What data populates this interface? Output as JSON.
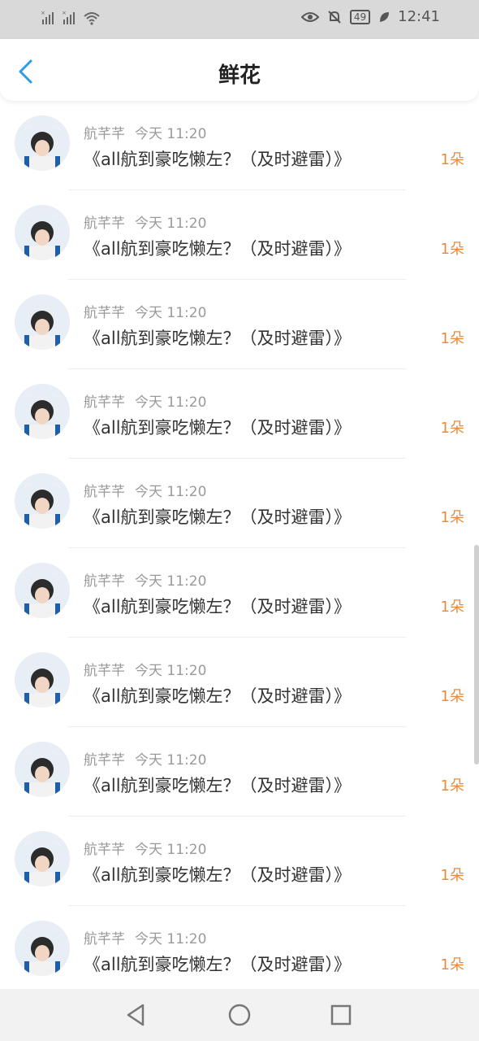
{
  "status_bar": {
    "time": "12:41",
    "battery": "49",
    "icons": [
      "signal-icon",
      "signal-icon",
      "wifi-icon",
      "eye-icon",
      "mute-bell-icon",
      "battery-icon",
      "leaf-icon"
    ]
  },
  "header": {
    "title": "鲜花",
    "back_icon": "chevron-left-icon"
  },
  "rows": [
    {
      "name": "航芊芊",
      "time": "今天 11:20",
      "title": "《all航到豪吃懒左？（及时避雷）》",
      "count": "1朵"
    },
    {
      "name": "航芊芊",
      "time": "今天 11:20",
      "title": "《all航到豪吃懒左？（及时避雷）》",
      "count": "1朵"
    },
    {
      "name": "航芊芊",
      "time": "今天 11:20",
      "title": "《all航到豪吃懒左？（及时避雷）》",
      "count": "1朵"
    },
    {
      "name": "航芊芊",
      "time": "今天 11:20",
      "title": "《all航到豪吃懒左？（及时避雷）》",
      "count": "1朵"
    },
    {
      "name": "航芊芊",
      "time": "今天 11:20",
      "title": "《all航到豪吃懒左？（及时避雷）》",
      "count": "1朵"
    },
    {
      "name": "航芊芊",
      "time": "今天 11:20",
      "title": "《all航到豪吃懒左？（及时避雷）》",
      "count": "1朵"
    },
    {
      "name": "航芊芊",
      "time": "今天 11:20",
      "title": "《all航到豪吃懒左？（及时避雷）》",
      "count": "1朵"
    },
    {
      "name": "航芊芊",
      "time": "今天 11:20",
      "title": "《all航到豪吃懒左？（及时避雷）》",
      "count": "1朵"
    },
    {
      "name": "航芊芊",
      "time": "今天 11:20",
      "title": "《all航到豪吃懒左？（及时避雷）》",
      "count": "1朵"
    },
    {
      "name": "航芊芊",
      "time": "今天 11:20",
      "title": "《all航到豪吃懒左？（及时避雷）》",
      "count": "1朵"
    }
  ],
  "bottom_nav": {
    "icons": [
      "back-triangle-icon",
      "home-circle-icon",
      "recents-square-icon"
    ]
  },
  "colors": {
    "accent_blue": "#2a9be6",
    "count_orange": "#e98a3b"
  }
}
